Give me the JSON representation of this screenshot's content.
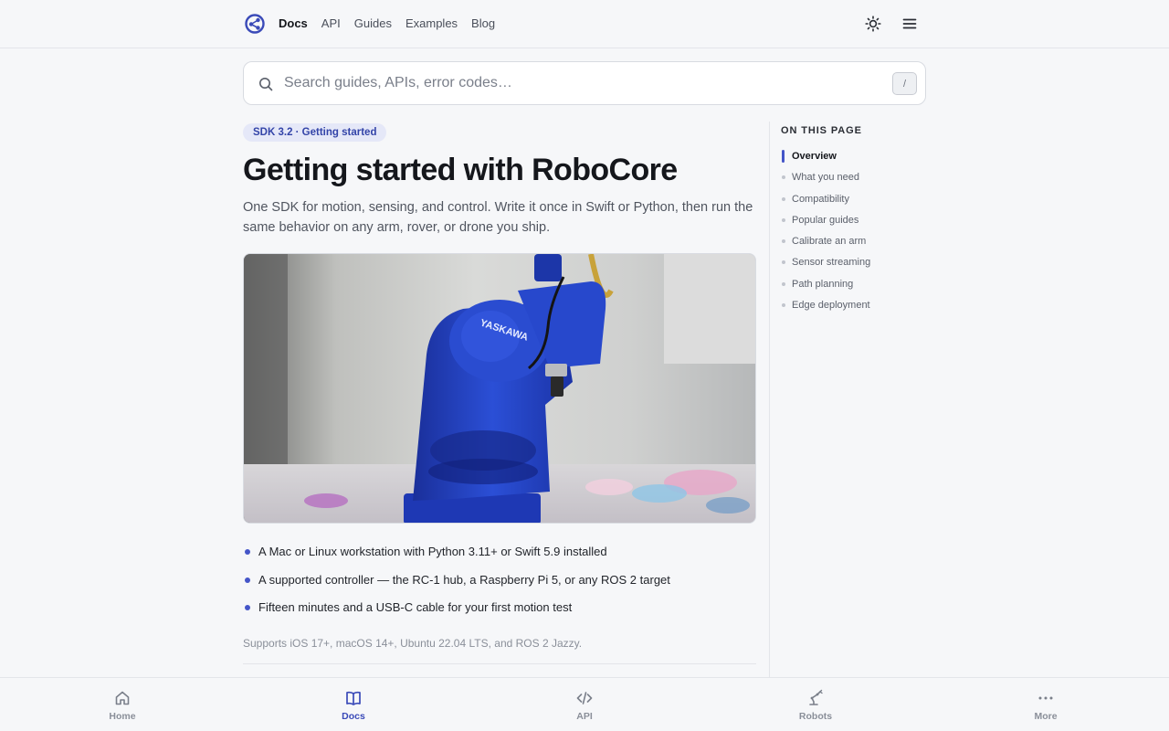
{
  "nav": {
    "links": [
      {
        "label": "Docs",
        "active": true
      },
      {
        "label": "API",
        "active": false
      },
      {
        "label": "Guides",
        "active": false
      },
      {
        "label": "Examples",
        "active": false
      },
      {
        "label": "Blog",
        "active": false
      }
    ],
    "icons": [
      "logo-icon",
      "sun-icon",
      "menu-icon"
    ]
  },
  "search": {
    "placeholder": "Search guides, APIs, error codes…",
    "value": "",
    "shortcut": "/"
  },
  "article": {
    "badge": "SDK 3.2 · Getting started",
    "title": "Getting started with RoboCore",
    "lede": "One SDK for motion, sensing, and control. Write it once in Swift or Python, then run the same behavior on any arm, rover, or drone you ship.",
    "hero_caption": "YASKAWA",
    "requirements": [
      "A Mac or Linux workstation with Python 3.11+ or Swift 5.9 installed",
      "A supported controller — the RC-1 hub, a Raspberry Pi 5, or any ROS 2 target",
      "Fifteen minutes and a USB-C cable for your first motion test"
    ],
    "support_note": "Supports iOS 17+, macOS 14+, Ubuntu 22.04 LTS, and ROS 2 Jazzy."
  },
  "toc": {
    "heading": "On this page",
    "items": [
      {
        "label": "Overview",
        "active": true
      },
      {
        "label": "What you need",
        "active": false
      },
      {
        "label": "Compatibility",
        "active": false
      },
      {
        "label": "Popular guides",
        "active": false
      },
      {
        "label": "Calibrate an arm",
        "active": false
      },
      {
        "label": "Sensor streaming",
        "active": false
      },
      {
        "label": "Path planning",
        "active": false
      },
      {
        "label": "Edge deployment",
        "active": false
      }
    ]
  },
  "tabbar": {
    "tabs": [
      {
        "label": "Home",
        "icon": "home-icon",
        "active": false
      },
      {
        "label": "Docs",
        "icon": "book-icon",
        "active": true
      },
      {
        "label": "API",
        "icon": "code-icon",
        "active": false
      },
      {
        "label": "Robots",
        "icon": "robot-arm-icon",
        "active": false
      },
      {
        "label": "More",
        "icon": "more-icon",
        "active": false
      }
    ]
  },
  "colors": {
    "accent": "#3a4ab8",
    "background": "#f6f7f9",
    "badge_bg": "#e5e8f8",
    "robot_blue": "#2546c8"
  }
}
